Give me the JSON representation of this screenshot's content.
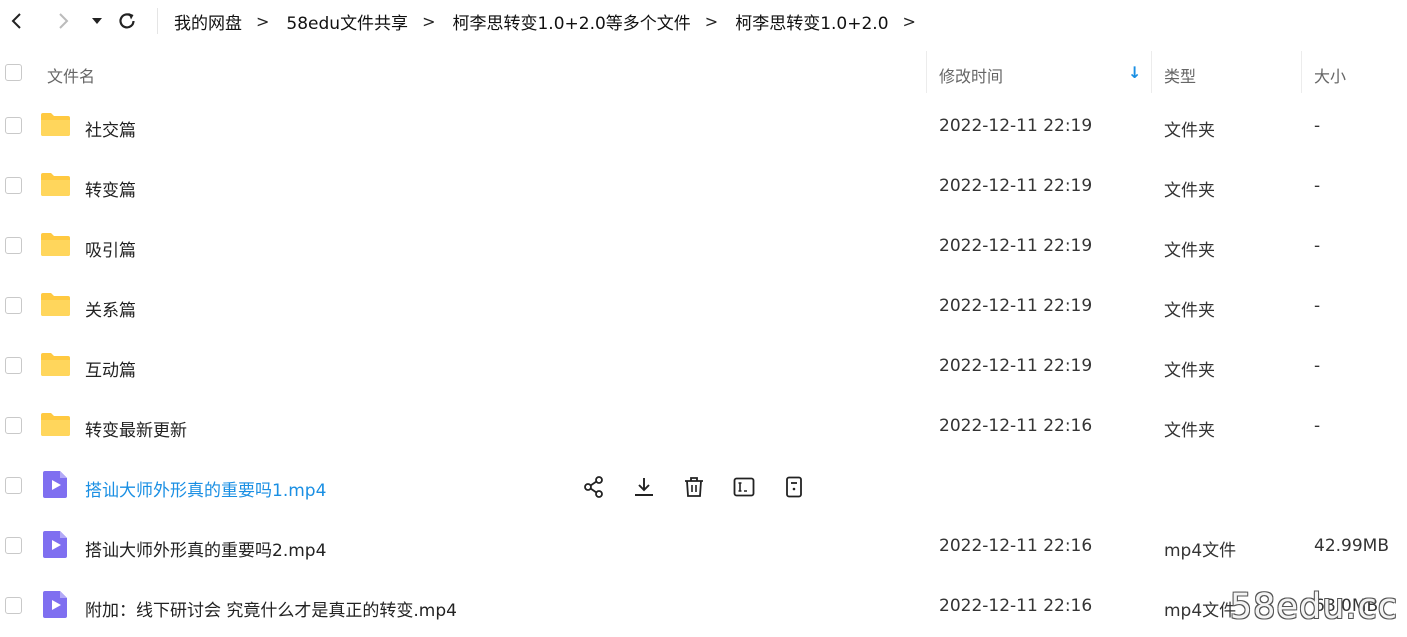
{
  "breadcrumb": [
    "我的网盘",
    "58edu文件共享",
    "柯李思转变1.0+2.0等多个文件",
    "柯李思转变1.0+2.0"
  ],
  "separator": ">",
  "columns": {
    "name": "文件名",
    "modified": "修改时间",
    "type": "类型",
    "size": "大小"
  },
  "sort_indicator": "↓",
  "files": [
    {
      "name": "社交篇",
      "modified": "2022-12-11 22:19",
      "type": "文件夹",
      "size": "-",
      "kind": "folder"
    },
    {
      "name": "转变篇",
      "modified": "2022-12-11 22:19",
      "type": "文件夹",
      "size": "-",
      "kind": "folder"
    },
    {
      "name": "吸引篇",
      "modified": "2022-12-11 22:19",
      "type": "文件夹",
      "size": "-",
      "kind": "folder"
    },
    {
      "name": "关系篇",
      "modified": "2022-12-11 22:19",
      "type": "文件夹",
      "size": "-",
      "kind": "folder"
    },
    {
      "name": "互动篇",
      "modified": "2022-12-11 22:19",
      "type": "文件夹",
      "size": "-",
      "kind": "folder"
    },
    {
      "name": "转变最新更新",
      "modified": "2022-12-11 22:16",
      "type": "文件夹",
      "size": "-",
      "kind": "folder"
    },
    {
      "name": "搭讪大师外形真的重要吗1.mp4",
      "modified": "",
      "type": "",
      "size": "",
      "kind": "video",
      "hovered": true
    },
    {
      "name": "搭讪大师外形真的重要吗2.mp4",
      "modified": "2022-12-11 22:16",
      "type": "mp4文件",
      "size": "42.99MB",
      "kind": "video"
    },
    {
      "name": "附加：线下研讨会  究竟什么才是真正的转变.mp4",
      "modified": "2022-12-11 22:16",
      "type": "mp4文件",
      "size": "68.0MB",
      "kind": "video"
    }
  ],
  "hover_actions": [
    "share-icon",
    "download-icon",
    "delete-icon",
    "rename-icon",
    "more-icon"
  ],
  "watermark": "58edu.cc",
  "colors": {
    "folder": "#ffc940",
    "video": "#7f6ff0",
    "link": "#1a8fe3",
    "sort": "#1a8fe3"
  }
}
